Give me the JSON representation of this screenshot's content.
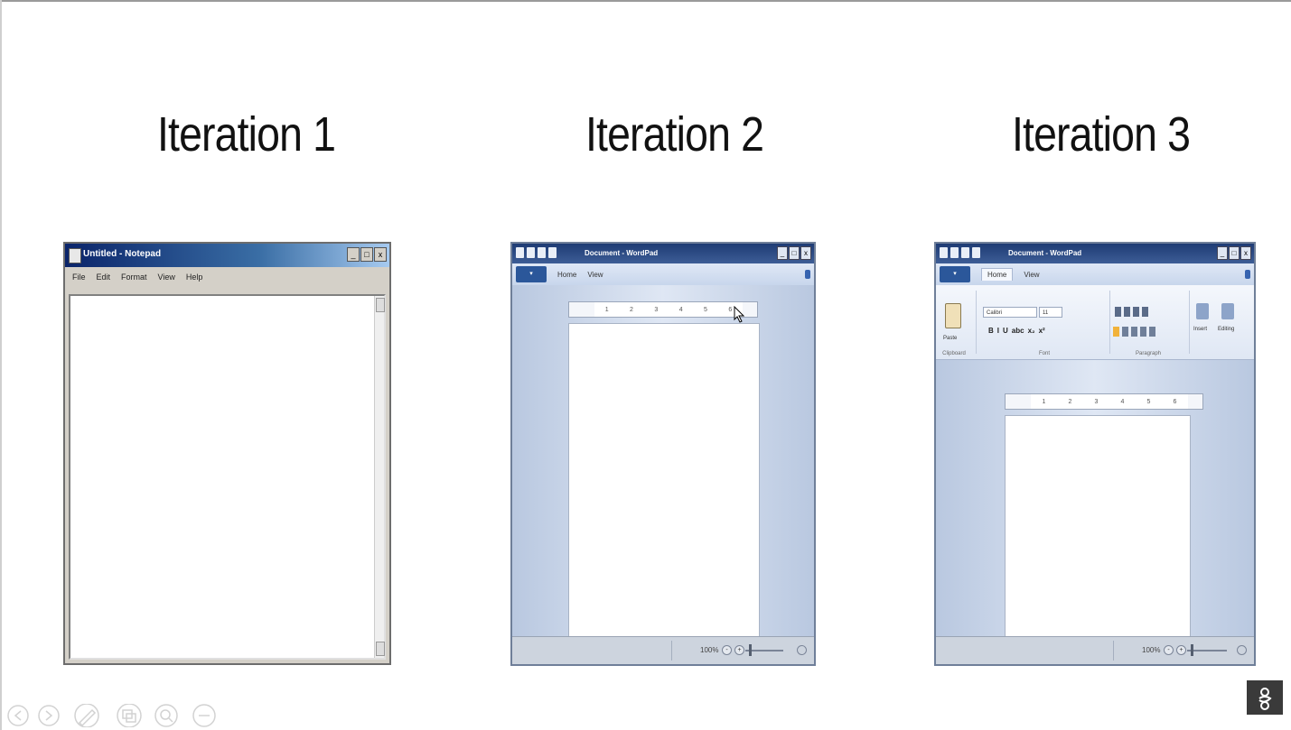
{
  "titles": [
    "Iteration 1",
    "Iteration 2",
    "Iteration 3"
  ],
  "notepad": {
    "window_title": "Untitled - Notepad",
    "menu": [
      "File",
      "Edit",
      "Format",
      "View",
      "Help"
    ],
    "controls": [
      "_",
      "□",
      "x"
    ]
  },
  "wordpad2": {
    "window_title": "Document - WordPad",
    "tabs": [
      "Home",
      "View"
    ],
    "zoom_percent": "100%",
    "zoom_minus": "-",
    "zoom_plus": "+",
    "controls": [
      "_",
      "□",
      "x"
    ]
  },
  "wordpad3": {
    "window_title": "Document - WordPad",
    "tabs": [
      "Home",
      "View"
    ],
    "font_name": "Calibri",
    "font_size": "11",
    "format_buttons": [
      "B",
      "I",
      "U",
      "abc",
      "x₂",
      "x²"
    ],
    "group_labels": [
      "Clipboard",
      "Font",
      "Paragraph"
    ],
    "paste_label": "Paste",
    "insert_label": "Insert",
    "editing_label": "Editing",
    "zoom_percent": "100%",
    "zoom_minus": "-",
    "zoom_plus": "+",
    "controls": [
      "_",
      "□",
      "x"
    ]
  },
  "ruler_marks": [
    "1",
    "2",
    "3",
    "4",
    "5",
    "6"
  ],
  "colors": {
    "notepad_titlebar": "#0a246a",
    "ribbon_titlebar": "#1e3b74",
    "ribbon_body": "#c9d6ea",
    "highlight": "#f1b23a"
  }
}
